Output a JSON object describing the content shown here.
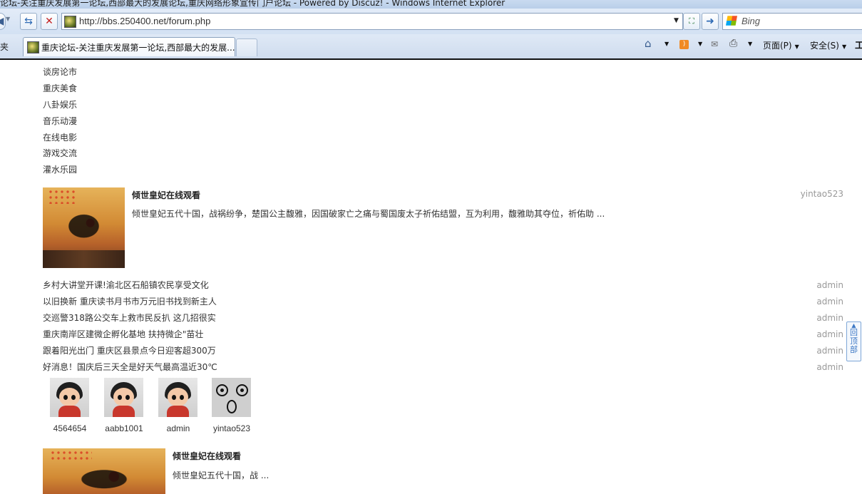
{
  "browser": {
    "window_title": "论坛-关注重庆发展第一论坛,西部最大的发展论坛,重庆网络形象宣传门户论坛 - Powered by Discuz! - Windows Internet Explorer",
    "url": "http://bbs.250400.net/forum.php",
    "search_placeholder": "Bing",
    "favorites_label": "夹",
    "tab_title": "重庆论坛-关注重庆发展第一论坛,西部最大的发展...",
    "page_menu_label": "页面(P)",
    "safety_menu_label": "安全(S)",
    "tools_label": "工",
    "icons": [
      "back-icon",
      "refresh-icon",
      "stop-icon",
      "compat-icon",
      "go-icon",
      "home-icon",
      "feed-icon",
      "mail-icon",
      "print-icon"
    ]
  },
  "forum_list": [
    {
      "name": "谈房论市"
    },
    {
      "name": "重庆美食"
    },
    {
      "name": "八卦娱乐"
    },
    {
      "name": "音乐动漫"
    },
    {
      "name": "在线电影"
    },
    {
      "name": "游戏交流"
    },
    {
      "name": "灌水乐园"
    }
  ],
  "featured_post": {
    "title": "倾世皇妃在线观看",
    "excerpt": "倾世皇妃五代十国，战祸纷争，楚国公主馥雅，因国破家亡之痛与蜀国废太子祈佑结盟，互为利用，馥雅助其夺位，祈佑助 ...",
    "author": "yintao523"
  },
  "news": [
    {
      "title": "乡村大讲堂开课!渝北区石船镇农民享受文化",
      "author": "admin"
    },
    {
      "title": "以旧换新 重庆读书月书市万元旧书找到新主人",
      "author": "admin"
    },
    {
      "title": "交巡警318路公交车上救市民反扒 这几招很实",
      "author": "admin"
    },
    {
      "title": "重庆南岸区建微企孵化基地 扶持微企\"苗壮",
      "author": "admin"
    },
    {
      "title": "跟着阳光出门 重庆区县景点今日迎客超300万",
      "author": "admin"
    },
    {
      "title": "好消息！国庆后三天全是好天气最高温近30℃",
      "author": "admin"
    }
  ],
  "members": [
    {
      "name": "4564654",
      "avatar": "cartoon-girl"
    },
    {
      "name": "aabb1001",
      "avatar": "cartoon-girl"
    },
    {
      "name": "admin",
      "avatar": "cartoon-girl"
    },
    {
      "name": "yintao523",
      "avatar": "surprised-face"
    }
  ],
  "second_post": {
    "title": "倾世皇妃在线观看",
    "excerpt": "倾世皇妃五代十国，战 ..."
  },
  "back_to_top": {
    "label": "回顶部"
  }
}
